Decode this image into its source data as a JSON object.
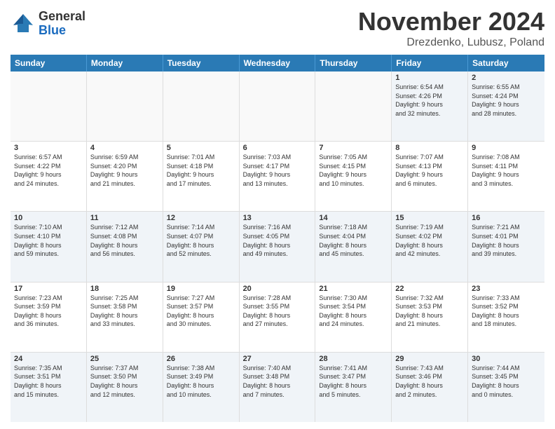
{
  "logo": {
    "general": "General",
    "blue": "Blue"
  },
  "title": "November 2024",
  "location": "Drezdenko, Lubusz, Poland",
  "header_days": [
    "Sunday",
    "Monday",
    "Tuesday",
    "Wednesday",
    "Thursday",
    "Friday",
    "Saturday"
  ],
  "rows": [
    [
      {
        "day": "",
        "info": ""
      },
      {
        "day": "",
        "info": ""
      },
      {
        "day": "",
        "info": ""
      },
      {
        "day": "",
        "info": ""
      },
      {
        "day": "",
        "info": ""
      },
      {
        "day": "1",
        "info": "Sunrise: 6:54 AM\nSunset: 4:26 PM\nDaylight: 9 hours\nand 32 minutes."
      },
      {
        "day": "2",
        "info": "Sunrise: 6:55 AM\nSunset: 4:24 PM\nDaylight: 9 hours\nand 28 minutes."
      }
    ],
    [
      {
        "day": "3",
        "info": "Sunrise: 6:57 AM\nSunset: 4:22 PM\nDaylight: 9 hours\nand 24 minutes."
      },
      {
        "day": "4",
        "info": "Sunrise: 6:59 AM\nSunset: 4:20 PM\nDaylight: 9 hours\nand 21 minutes."
      },
      {
        "day": "5",
        "info": "Sunrise: 7:01 AM\nSunset: 4:18 PM\nDaylight: 9 hours\nand 17 minutes."
      },
      {
        "day": "6",
        "info": "Sunrise: 7:03 AM\nSunset: 4:17 PM\nDaylight: 9 hours\nand 13 minutes."
      },
      {
        "day": "7",
        "info": "Sunrise: 7:05 AM\nSunset: 4:15 PM\nDaylight: 9 hours\nand 10 minutes."
      },
      {
        "day": "8",
        "info": "Sunrise: 7:07 AM\nSunset: 4:13 PM\nDaylight: 9 hours\nand 6 minutes."
      },
      {
        "day": "9",
        "info": "Sunrise: 7:08 AM\nSunset: 4:11 PM\nDaylight: 9 hours\nand 3 minutes."
      }
    ],
    [
      {
        "day": "10",
        "info": "Sunrise: 7:10 AM\nSunset: 4:10 PM\nDaylight: 8 hours\nand 59 minutes."
      },
      {
        "day": "11",
        "info": "Sunrise: 7:12 AM\nSunset: 4:08 PM\nDaylight: 8 hours\nand 56 minutes."
      },
      {
        "day": "12",
        "info": "Sunrise: 7:14 AM\nSunset: 4:07 PM\nDaylight: 8 hours\nand 52 minutes."
      },
      {
        "day": "13",
        "info": "Sunrise: 7:16 AM\nSunset: 4:05 PM\nDaylight: 8 hours\nand 49 minutes."
      },
      {
        "day": "14",
        "info": "Sunrise: 7:18 AM\nSunset: 4:04 PM\nDaylight: 8 hours\nand 45 minutes."
      },
      {
        "day": "15",
        "info": "Sunrise: 7:19 AM\nSunset: 4:02 PM\nDaylight: 8 hours\nand 42 minutes."
      },
      {
        "day": "16",
        "info": "Sunrise: 7:21 AM\nSunset: 4:01 PM\nDaylight: 8 hours\nand 39 minutes."
      }
    ],
    [
      {
        "day": "17",
        "info": "Sunrise: 7:23 AM\nSunset: 3:59 PM\nDaylight: 8 hours\nand 36 minutes."
      },
      {
        "day": "18",
        "info": "Sunrise: 7:25 AM\nSunset: 3:58 PM\nDaylight: 8 hours\nand 33 minutes."
      },
      {
        "day": "19",
        "info": "Sunrise: 7:27 AM\nSunset: 3:57 PM\nDaylight: 8 hours\nand 30 minutes."
      },
      {
        "day": "20",
        "info": "Sunrise: 7:28 AM\nSunset: 3:55 PM\nDaylight: 8 hours\nand 27 minutes."
      },
      {
        "day": "21",
        "info": "Sunrise: 7:30 AM\nSunset: 3:54 PM\nDaylight: 8 hours\nand 24 minutes."
      },
      {
        "day": "22",
        "info": "Sunrise: 7:32 AM\nSunset: 3:53 PM\nDaylight: 8 hours\nand 21 minutes."
      },
      {
        "day": "23",
        "info": "Sunrise: 7:33 AM\nSunset: 3:52 PM\nDaylight: 8 hours\nand 18 minutes."
      }
    ],
    [
      {
        "day": "24",
        "info": "Sunrise: 7:35 AM\nSunset: 3:51 PM\nDaylight: 8 hours\nand 15 minutes."
      },
      {
        "day": "25",
        "info": "Sunrise: 7:37 AM\nSunset: 3:50 PM\nDaylight: 8 hours\nand 12 minutes."
      },
      {
        "day": "26",
        "info": "Sunrise: 7:38 AM\nSunset: 3:49 PM\nDaylight: 8 hours\nand 10 minutes."
      },
      {
        "day": "27",
        "info": "Sunrise: 7:40 AM\nSunset: 3:48 PM\nDaylight: 8 hours\nand 7 minutes."
      },
      {
        "day": "28",
        "info": "Sunrise: 7:41 AM\nSunset: 3:47 PM\nDaylight: 8 hours\nand 5 minutes."
      },
      {
        "day": "29",
        "info": "Sunrise: 7:43 AM\nSunset: 3:46 PM\nDaylight: 8 hours\nand 2 minutes."
      },
      {
        "day": "30",
        "info": "Sunrise: 7:44 AM\nSunset: 3:45 PM\nDaylight: 8 hours\nand 0 minutes."
      }
    ]
  ]
}
